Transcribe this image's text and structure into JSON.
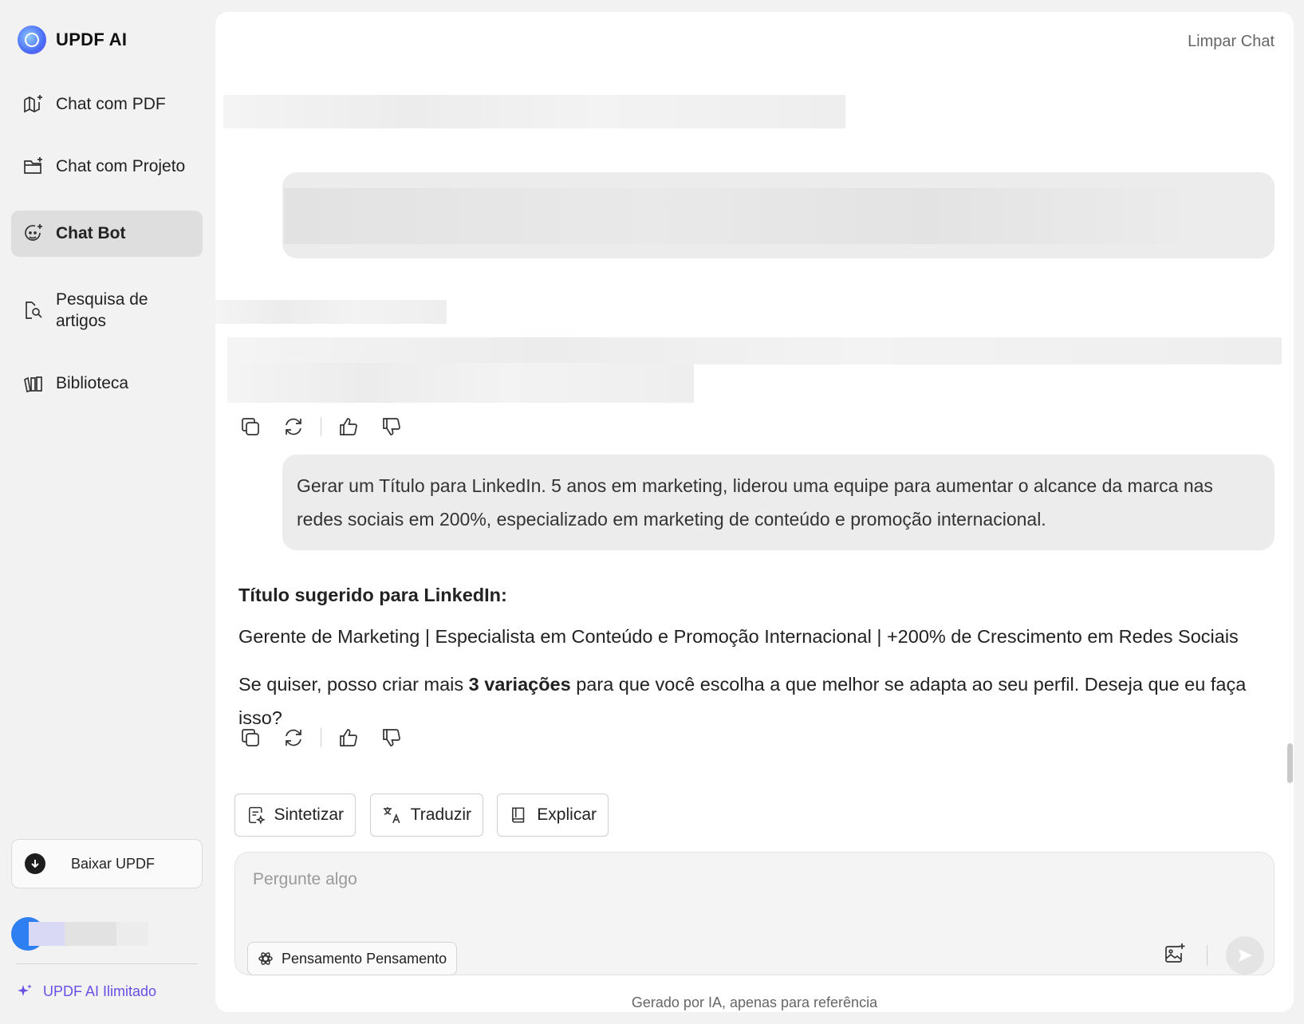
{
  "app": {
    "logo_text": "UPDF AI",
    "accent_color": "#6b4ee6"
  },
  "sidebar": {
    "items": [
      {
        "label": "Chat com PDF",
        "icon": "book-sparkle-icon",
        "active": false
      },
      {
        "label": "Chat com Projeto",
        "icon": "folder-sparkle-icon",
        "active": false
      },
      {
        "label": "Chat Bot",
        "icon": "bot-face-icon",
        "active": true
      },
      {
        "label": "Pesquisa de artigos",
        "icon": "doc-search-icon",
        "active": false
      },
      {
        "label": "Biblioteca",
        "icon": "library-icon",
        "active": false
      }
    ],
    "download_label": "Baixar UPDF",
    "unlimited_label": "UPDF AI Ilimitado"
  },
  "header": {
    "clear_chat_label": "Limpar Chat"
  },
  "chat": {
    "user_message": "Gerar um Título para LinkedIn. 5 anos em marketing, liderou uma equipe para aumentar o alcance da marca nas redes sociais em 200%, especializado em marketing de conteúdo e promoção internacional.",
    "answer": {
      "title": "Título sugerido para LinkedIn:",
      "headline": "Gerente de Marketing | Especialista em Conteúdo e Promoção Internacional | +200% de Crescimento em Redes Sociais",
      "follow_before": "Se quiser, posso criar mais ",
      "follow_bold": "3 variações",
      "follow_after": " para que você escolha a que melhor se adapta ao seu perfil. Deseja que eu faça isso?"
    }
  },
  "quick_actions": [
    {
      "label": "Sintetizar",
      "icon": "summarize-icon"
    },
    {
      "label": "Traduzir",
      "icon": "translate-icon"
    },
    {
      "label": "Explicar",
      "icon": "book-icon"
    }
  ],
  "input": {
    "placeholder": "Pergunte algo",
    "value": "",
    "thinking_label": "Pensamento Pensamento"
  },
  "footer": {
    "disclaimer": "Gerado por IA, apenas para referência"
  }
}
